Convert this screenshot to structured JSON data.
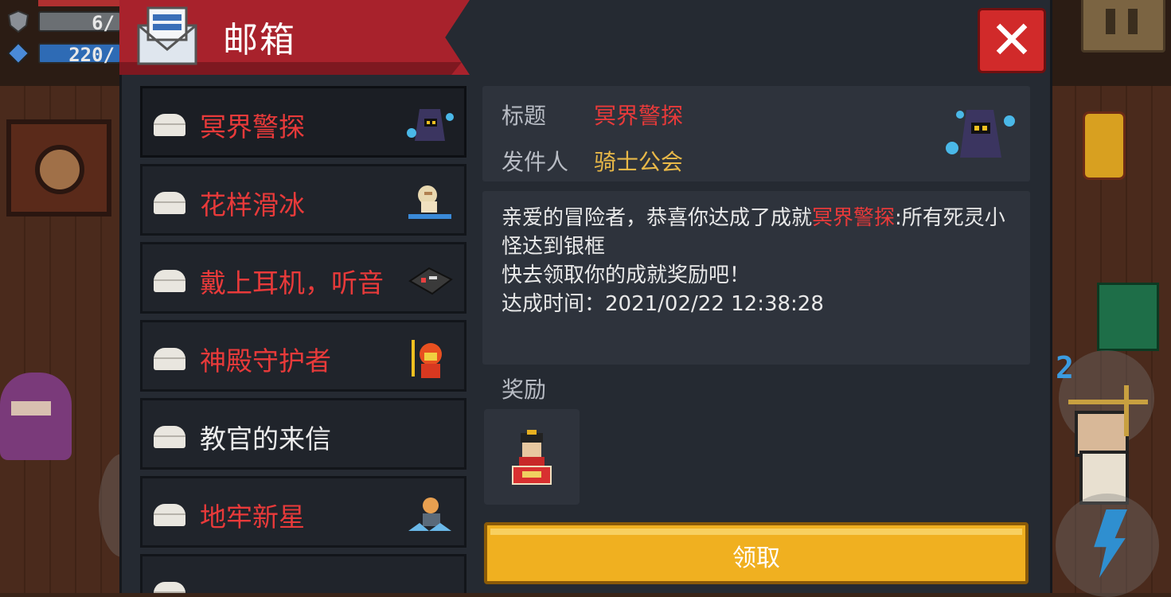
{
  "hud": {
    "shield_value": "6/",
    "energy_value": "220/"
  },
  "window": {
    "title": "邮箱",
    "close_label": "✕"
  },
  "mail_list": [
    {
      "label": "冥界警探",
      "color": "red",
      "icon": "hooded-ghost-icon"
    },
    {
      "label": "花样滑冰",
      "color": "red",
      "icon": "skater-icon"
    },
    {
      "label": "戴上耳机，听音",
      "color": "red",
      "icon": "headphone-device-icon"
    },
    {
      "label": "神殿守护者",
      "color": "red",
      "icon": "temple-guardian-icon"
    },
    {
      "label": "教官的来信",
      "color": "white",
      "icon": ""
    },
    {
      "label": "地牢新星",
      "color": "red",
      "icon": "dungeon-star-icon"
    },
    {
      "label": "",
      "color": "red",
      "icon": ""
    }
  ],
  "detail": {
    "title_label": "标题",
    "title_value": "冥界警探",
    "sender_label": "发件人",
    "sender_value": "骑士公会",
    "body_prefix": "亲爱的冒险者，恭喜你达成了成就",
    "body_highlight": "冥界警探",
    "body_rest": ":所有死灵小怪达到银框",
    "body_line2": "快去领取你的成就奖励吧！",
    "body_line3": "达成时间：2021/02/22 12:38:28",
    "reward_label": "奖励",
    "claim_label": "领取"
  },
  "colors": {
    "accent_red": "#e83a3a",
    "gold": "#e8b848",
    "button": "#f0b020",
    "ribbon": "#a8222c"
  }
}
